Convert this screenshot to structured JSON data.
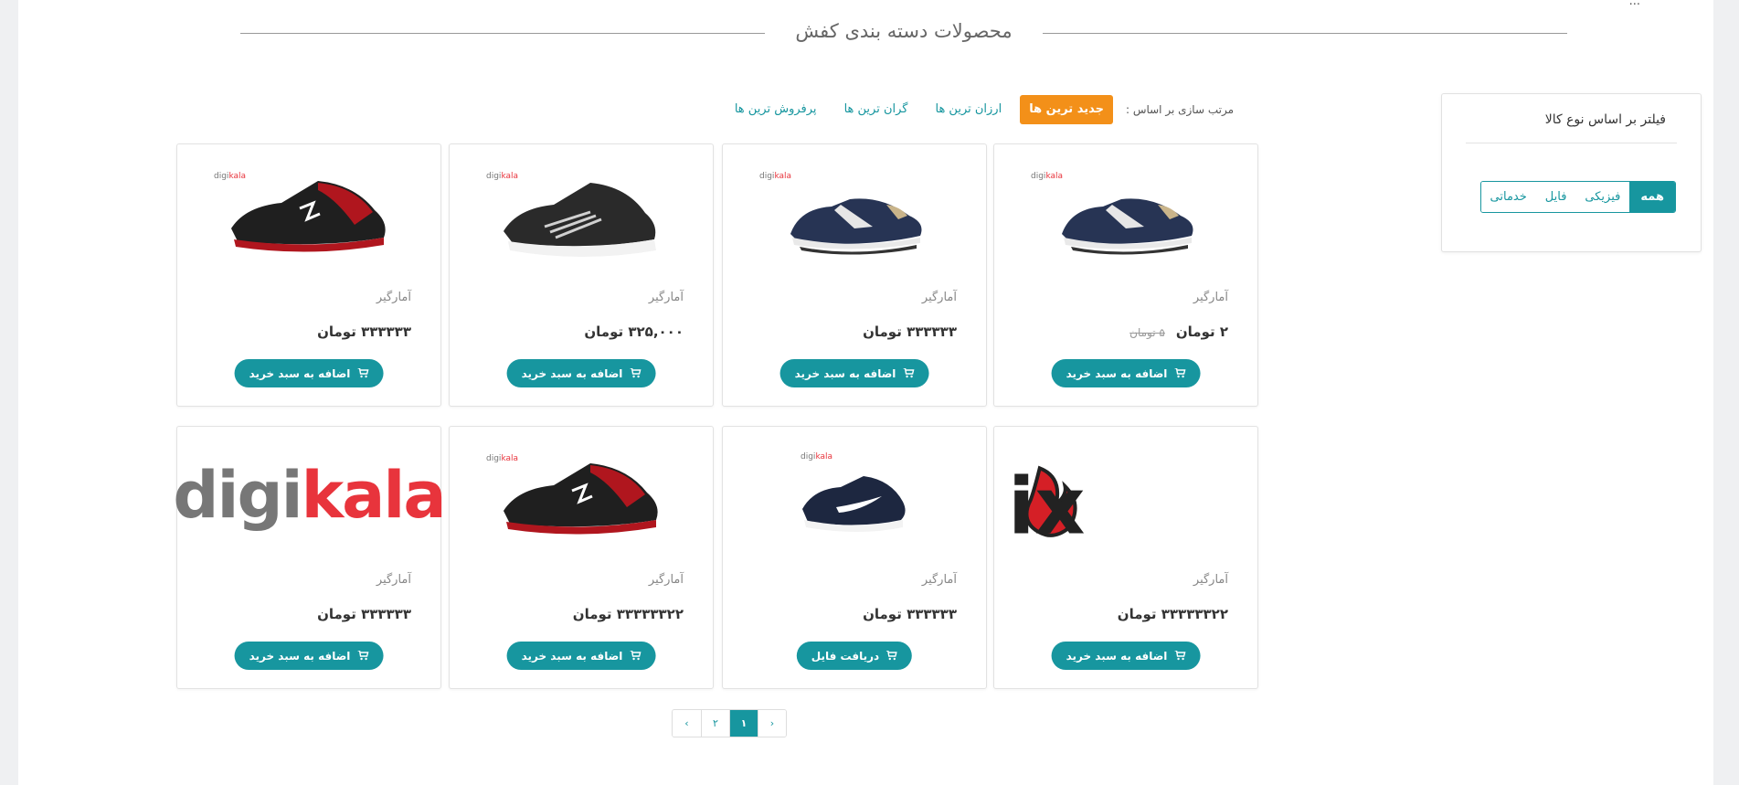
{
  "breadcrumb": {
    "text": "..."
  },
  "section": {
    "title": "محصولات دسته بندی کفش"
  },
  "filter": {
    "title": "فیلتر بر اساس نوع کالا",
    "options": [
      "همه",
      "فیزیکی",
      "فایل",
      "خدماتی"
    ],
    "selected": "همه"
  },
  "sort": {
    "label": "مرتب سازی بر اساس :",
    "items": [
      "جدید ترین ها",
      "ارزان ترین ها",
      "گران ترین ها",
      "پرفروش ترین ها"
    ],
    "active": "جدید ترین ها"
  },
  "products": [
    {
      "image": "diadora-navy-sneaker",
      "brand": "آمارگیر",
      "price": "۲ تومان",
      "old_price": "۵ تومان",
      "button": "اضافه به سبد خرید"
    },
    {
      "image": "diadora-navy-sneaker",
      "brand": "آمارگیر",
      "price": "۳۳۳۳۳۳ تومان",
      "old_price": "",
      "button": "اضافه به سبد خرید"
    },
    {
      "image": "black-white-running-shoe",
      "brand": "آمارگیر",
      "price": "۳۲۵,۰۰۰ تومان",
      "old_price": "",
      "button": "اضافه به سبد خرید"
    },
    {
      "image": "black-red-running-shoe",
      "brand": "آمارگیر",
      "price": "۳۳۳۳۳۳ تومان",
      "old_price": "",
      "button": "اضافه به سبد خرید"
    },
    {
      "image": "stix-logo",
      "brand": "آمارگیر",
      "price": "۳۳۳۳۳۳۲۲ تومان",
      "old_price": "",
      "button": "اضافه به سبد خرید"
    },
    {
      "image": "nike-navy-sneaker",
      "brand": "آمارگیر",
      "price": "۳۳۳۳۳۳ تومان",
      "old_price": "",
      "button": "دریافت فایل"
    },
    {
      "image": "black-red-running-shoe",
      "brand": "آمارگیر",
      "price": "۳۳۳۳۳۳۲۲ تومان",
      "old_price": "",
      "button": "اضافه به سبد خرید"
    },
    {
      "image": "digikala-logo",
      "brand": "آمارگیر",
      "price": "۳۳۳۳۳۳ تومان",
      "old_price": "",
      "button": "اضافه به سبد خرید"
    }
  ],
  "logos": {
    "digikala_a": "digi",
    "digikala_b": "kala",
    "stix": "stix"
  },
  "pagination": {
    "prev": "›",
    "pages": [
      "۱",
      "۲"
    ],
    "next": "‹",
    "current": "۱"
  },
  "colors": {
    "accent": "#17969f",
    "active_sort": "#f39019"
  }
}
